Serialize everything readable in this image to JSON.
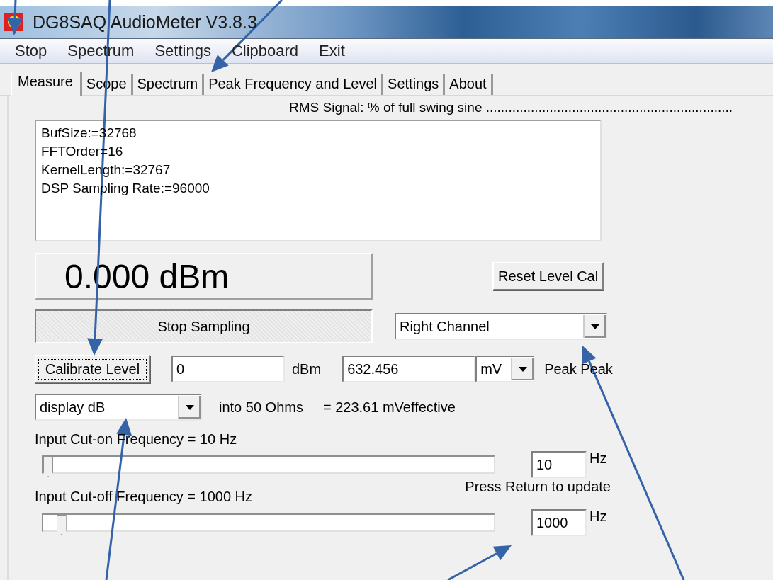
{
  "window": {
    "title": "DG8SAQ AudioMeter V3.8.3"
  },
  "menu": [
    "Stop",
    "Spectrum",
    "Settings",
    "Clipboard",
    "Exit"
  ],
  "tabs": [
    {
      "label": "Measure",
      "selected": true
    },
    {
      "label": "Scope",
      "selected": false
    },
    {
      "label": "Spectrum",
      "selected": false
    },
    {
      "label": "Peak Frequency and Level",
      "selected": false
    },
    {
      "label": "Settings",
      "selected": false
    },
    {
      "label": "About",
      "selected": false
    }
  ],
  "measure": {
    "caption": "RMS Signal: % of full swing sine ..................................................................",
    "info_lines": [
      "BufSize:=32768",
      "FFTOrder=16",
      "KernelLength:=32767",
      "DSP Sampling Rate:=96000"
    ],
    "readout": "0.000 dBm",
    "reset_button": "Reset Level Cal",
    "stop_button": {
      "label": "Stop Sampling",
      "pressed": true
    },
    "channel": "Right Channel",
    "calibrate_button": {
      "label": "Calibrate Level",
      "focused": true
    },
    "level_value": "0",
    "level_unit": "dBm",
    "voltage_value": "632.456",
    "voltage_unit": "mV",
    "voltage_mode": "Peak Peak",
    "display_mode": "display dB",
    "impedance": "into 50 Ohms",
    "effective": "= 223.61 mVeffective",
    "cut_on": {
      "label": "Input Cut-on Frequency = 10 Hz",
      "level": 0,
      "value": "10",
      "unit": "Hz"
    },
    "hint": "Press Return to update",
    "cut_off": {
      "label": "Input Cut-off Frequency = 1000 Hz",
      "level": 0.03,
      "value": "1000",
      "unit": "Hz"
    }
  }
}
